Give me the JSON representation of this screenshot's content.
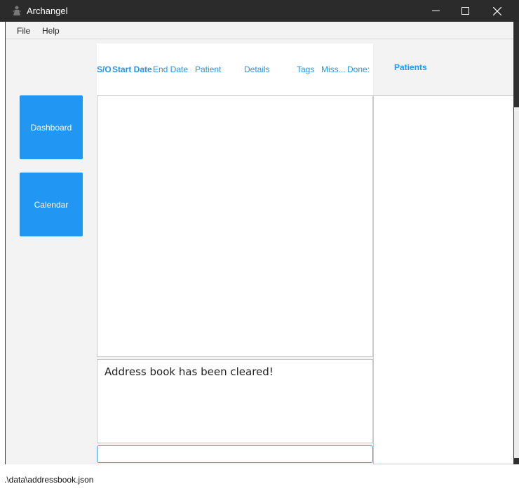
{
  "window": {
    "title": "Archangel",
    "controls": {
      "minimize": "—",
      "maximize": "☐",
      "close": "✕"
    }
  },
  "menu": {
    "file": "File",
    "help": "Help"
  },
  "sidebar": {
    "dashboard_label": "Dashboard",
    "calendar_label": "Calendar"
  },
  "appointments": {
    "columns": {
      "so": "S/O",
      "start_date": "Start Date",
      "end_date": "End Date",
      "patient": "Patient",
      "details": "Details",
      "tags": "Tags",
      "missed": "Miss...",
      "done": "Done:"
    }
  },
  "patients": {
    "title": "Patients"
  },
  "result": {
    "message": "Address book has been cleared!"
  },
  "command": {
    "value": "",
    "placeholder": ""
  },
  "status": {
    "path": ".\\data\\addressbook.json"
  },
  "colors": {
    "accent": "#2196f3",
    "titlebar": "#2b2b2b",
    "background": "#f3f3f3"
  }
}
